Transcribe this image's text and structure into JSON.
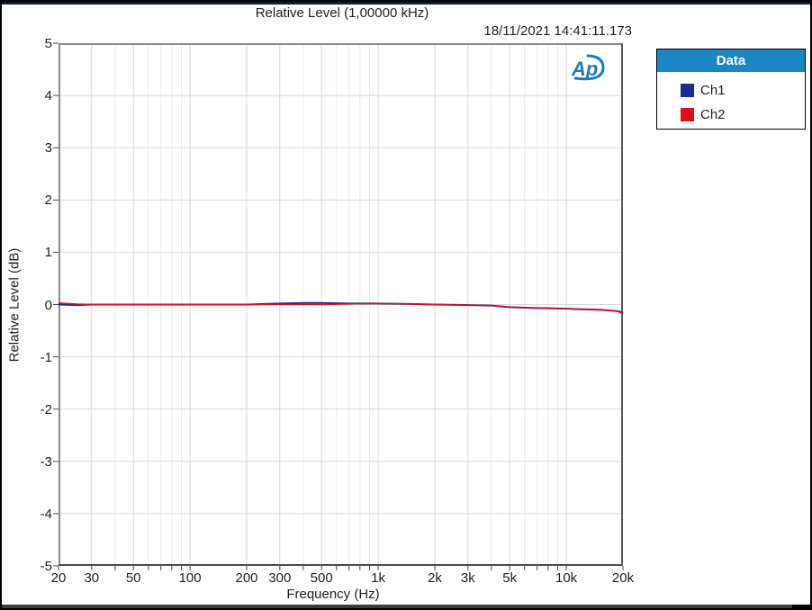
{
  "window": {
    "top_bar_color": "#0e1a3a",
    "bottom_bar_color": "#3c3c3c",
    "border_color": "#000000",
    "background": "#ffffff"
  },
  "header": {
    "title": "Relative Level (1,00000 kHz)",
    "timestamp": "18/11/2021 14:41:11.173"
  },
  "logo": {
    "name": "ap-logo",
    "text": "Ap",
    "color": "#1e7abe"
  },
  "legend": {
    "title": "Data",
    "header_bg": "#1b87c2",
    "items": [
      {
        "label": "Ch1",
        "color": "#222b8d"
      },
      {
        "label": "Ch2",
        "color": "#d8121a"
      }
    ]
  },
  "chart_data": {
    "type": "line",
    "title": "Relative Level (1,00000 kHz)",
    "timestamp": "18/11/2021 14:41:11.173",
    "xlabel": "Frequency (Hz)",
    "ylabel": "Relative Level (dB)",
    "xscale": "log",
    "xlim": [
      20,
      20000
    ],
    "ylim": [
      -5,
      5
    ],
    "grid": true,
    "legend_position": "top-right-outside",
    "x_major_ticks": [
      {
        "value": 20,
        "label": "20"
      },
      {
        "value": 30,
        "label": "30"
      },
      {
        "value": 50,
        "label": "50"
      },
      {
        "value": 100,
        "label": "100"
      },
      {
        "value": 200,
        "label": "200"
      },
      {
        "value": 300,
        "label": "300"
      },
      {
        "value": 500,
        "label": "500"
      },
      {
        "value": 1000,
        "label": "1k"
      },
      {
        "value": 2000,
        "label": "2k"
      },
      {
        "value": 3000,
        "label": "3k"
      },
      {
        "value": 5000,
        "label": "5k"
      },
      {
        "value": 10000,
        "label": "10k"
      },
      {
        "value": 20000,
        "label": "20k"
      }
    ],
    "x_minor_ticks": [
      40,
      60,
      70,
      80,
      90,
      400,
      600,
      700,
      800,
      900,
      4000,
      6000,
      7000,
      8000,
      9000
    ],
    "y_ticks": [
      5,
      4,
      3,
      2,
      1,
      0,
      -1,
      -2,
      -3,
      -4,
      -5
    ],
    "x_shared": [
      20,
      25,
      30,
      40,
      50,
      70,
      100,
      150,
      200,
      300,
      400,
      500,
      700,
      1000,
      1500,
      2000,
      3000,
      4000,
      5000,
      6000,
      8000,
      10000,
      12000,
      15000,
      18000,
      19000,
      20000
    ],
    "series": [
      {
        "name": "Ch1",
        "color": "#222b8d",
        "y": [
          0.0,
          -0.01,
          0.0,
          0.0,
          0.0,
          0.0,
          0.0,
          0.0,
          0.0,
          0.02,
          0.03,
          0.03,
          0.02,
          0.02,
          0.01,
          0.0,
          -0.01,
          -0.02,
          -0.05,
          -0.06,
          -0.07,
          -0.08,
          -0.09,
          -0.1,
          -0.12,
          -0.13,
          -0.16
        ]
      },
      {
        "name": "Ch2",
        "color": "#d8121a",
        "y": [
          0.03,
          0.01,
          0.0,
          0.0,
          0.0,
          0.0,
          0.0,
          0.0,
          0.0,
          0.0,
          0.0,
          0.0,
          0.01,
          0.02,
          0.01,
          0.0,
          -0.01,
          -0.02,
          -0.05,
          -0.06,
          -0.07,
          -0.08,
          -0.09,
          -0.1,
          -0.12,
          -0.14,
          -0.18
        ]
      }
    ],
    "colors": {
      "grid_major": "#d9d9d9",
      "grid_minor": "#ececec",
      "plot_border": "#8a8a8a",
      "axis_dark": "#4a4a4a",
      "text": "#1f1f1f"
    }
  }
}
